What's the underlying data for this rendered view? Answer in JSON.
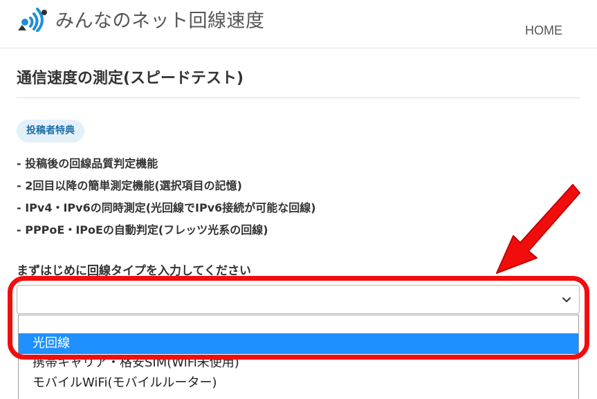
{
  "header": {
    "site_name": "みんなのネット回線速度",
    "nav_home": "HOME",
    "logo_icon": "wifi-signal-icon",
    "logo_colors": [
      "#1e8fd8",
      "#333333"
    ]
  },
  "main": {
    "title": "通信速度の測定(スピードテスト)",
    "badge": "投稿者特典",
    "features": [
      "- 投稿後の回線品質判定機能",
      "- 2回目以降の簡単測定機能(選択項目の記憶)",
      "- IPv4・IPv6の同時測定(光回線でIPv6接続が可能な回線)",
      "- PPPoE・IPoEの自動判定(フレッツ光系の回線)"
    ],
    "select_prompt": "まずはじめに回線タイプを入力してください",
    "select_value": "",
    "select_icon": "chevron-down-icon",
    "options": [
      "",
      "光回線",
      "携帯キャリア・格安SIM(WiFi未使用)",
      "モバイルWiFi(モバイルルーター)",
      ""
    ],
    "highlighted_option": "光回線"
  },
  "annotation": {
    "ring_color": "#f20d0d",
    "arrow_icon": "red-arrow-icon",
    "arrow_color": "#f20d0d"
  }
}
